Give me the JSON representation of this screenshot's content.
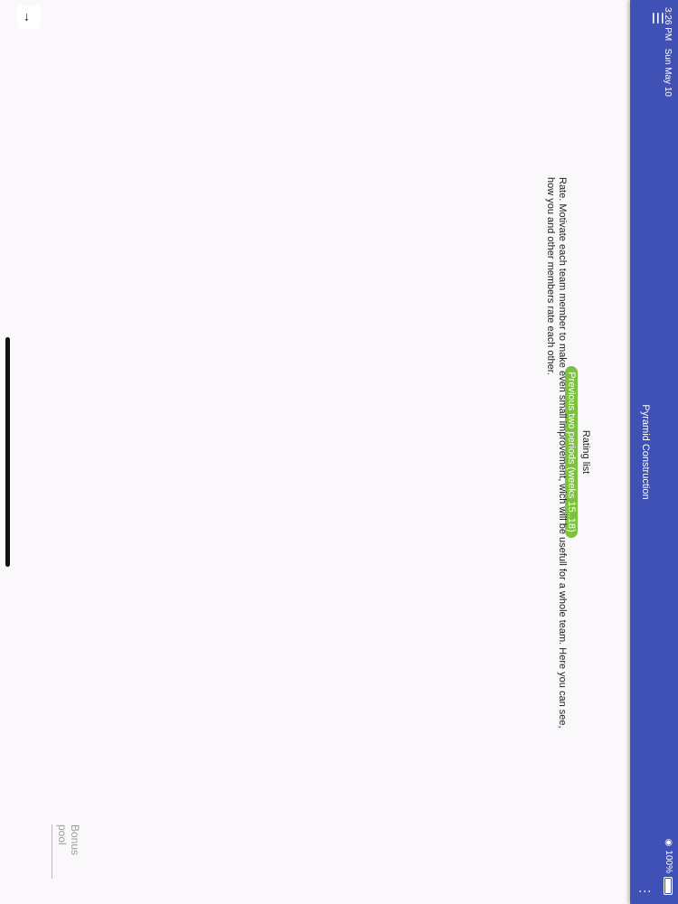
{
  "status_bar": {
    "time": "3:26 PM",
    "date": "Sun May 10",
    "battery": "100%"
  },
  "app_bar": {
    "title": "Pyramid Construction",
    "menu_icon": "hamburger-menu-icon",
    "more_icon": "more-vert-icon"
  },
  "content": {
    "heading": "Rating list",
    "period_badge": "Previous two periods (weeks 15..18)",
    "description": "Rate. Motivate each team member to make even small improvement, wich will be usefull for a whole team. Here you can see, how you and other members rate each other.",
    "bonus_field_label": "Bonus pool"
  },
  "scroll_up_icon": "arrow-up-icon",
  "colors": {
    "app_bar": "#3f51b5",
    "badge": "#7bc23f",
    "background": "#faf8fb"
  }
}
